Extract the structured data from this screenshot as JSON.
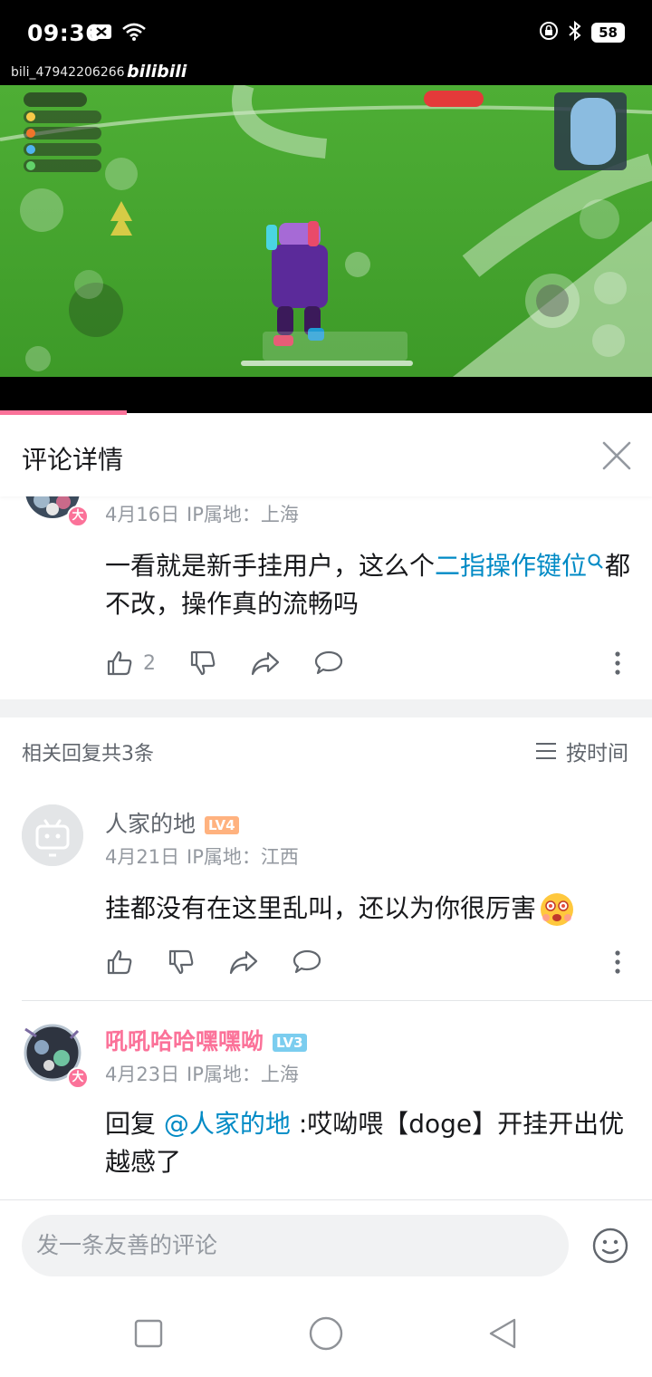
{
  "status_bar": {
    "time": "09:36",
    "battery": "58"
  },
  "watermark": {
    "user": "bili_47942206266",
    "logo": "bilibili"
  },
  "header": {
    "title": "评论详情"
  },
  "root_comment": {
    "date": "4月16日",
    "ip": "IP属地：上海",
    "text_before_link": "一看就是新手挂用户，这么个",
    "link_text": "二指操作键位",
    "text_after_link": "都不改，操作真的流畅吗",
    "like_count": "2"
  },
  "related": {
    "title": "相关回复共3条",
    "sort_label": "按时间"
  },
  "replies": [
    {
      "username": "人家的地",
      "level": "LV4",
      "date": "4月21日",
      "ip": "IP属地：江西",
      "text": "挂都没有在这里乱叫，还以为你很厉害"
    },
    {
      "username": "吼吼哈哈嘿嘿呦",
      "level": "LV3",
      "date": "4月23日",
      "ip": "IP属地：上海",
      "reply_prefix": "回复 ",
      "mention": "@人家的地",
      "text": " :哎呦喂【doge】开挂开出优越感了"
    }
  ],
  "input": {
    "placeholder": "发一条友善的评论"
  },
  "colors": {
    "brand_pink": "#fb7299",
    "link_blue": "#008ac5",
    "lv4_orange": "#ffb27f",
    "lv3_blue": "#7bcdef",
    "vip_name_pink": "#fb7299"
  }
}
